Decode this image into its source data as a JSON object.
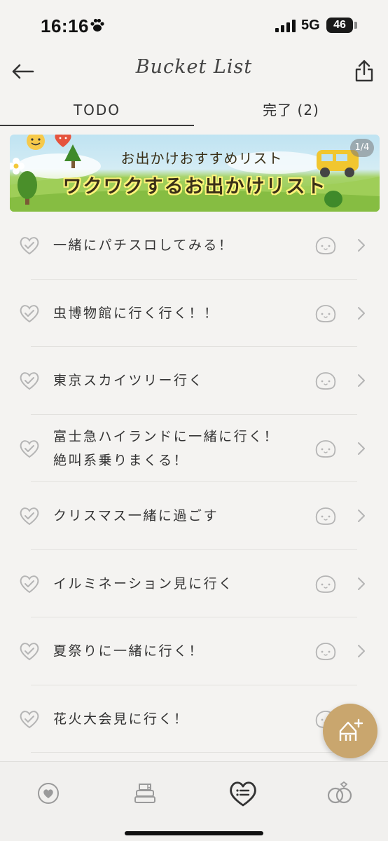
{
  "status_bar": {
    "time": "16:16",
    "network": "5G",
    "battery": "46"
  },
  "header": {
    "title": "Bucket List",
    "back_icon": "arrow-left-icon",
    "share_icon": "share-icon"
  },
  "tabs": [
    {
      "label": "TODO",
      "active": true
    },
    {
      "label": "完了 (2)",
      "active": false
    }
  ],
  "banner": {
    "subtitle": "お出かけおすすめリスト",
    "title": "ワクワクするお出かけリスト",
    "page": "1/4"
  },
  "items": [
    {
      "lines": [
        "一緒にパチスロしてみる！"
      ]
    },
    {
      "lines": [
        "虫博物館に行く行く！！"
      ]
    },
    {
      "lines": [
        "東京スカイツリー行く"
      ]
    },
    {
      "lines": [
        "富士急ハイランドに一緒に行く！",
        "絶叫系乗りまくる！"
      ]
    },
    {
      "lines": [
        "クリスマス一緒に過ごす"
      ]
    },
    {
      "lines": [
        "イルミネーション見に行く"
      ]
    },
    {
      "lines": [
        "夏祭りに一緒に行く！"
      ]
    },
    {
      "lines": [
        "花火大会見に行く！"
      ]
    }
  ],
  "fab": {
    "icon": "add-item-icon"
  },
  "bottom_nav": [
    {
      "icon": "heart-circle-icon",
      "active": false
    },
    {
      "icon": "books-icon",
      "active": false
    },
    {
      "icon": "heart-list-icon",
      "active": true
    },
    {
      "icon": "rings-icon",
      "active": false
    }
  ],
  "colors": {
    "background": "#f4f3f1",
    "fab": "#c9a66e",
    "text": "#333333"
  }
}
